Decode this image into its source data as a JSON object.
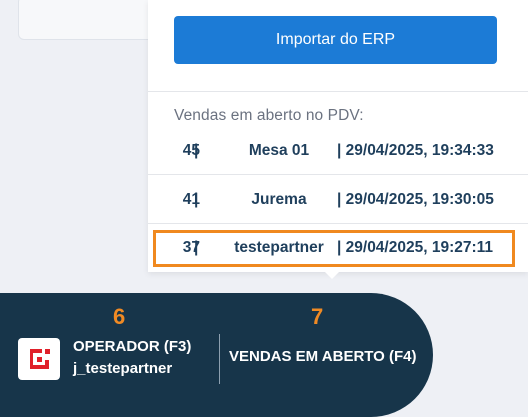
{
  "popup": {
    "import_button": "Importar do ERP",
    "section_title": "Vendas em aberto no PDV:",
    "sales": [
      {
        "number": "45",
        "name": "Mesa 01",
        "date": "| 29/04/2025, 19:34:33"
      },
      {
        "number": "41",
        "name": "Jurema",
        "date": "| 29/04/2025, 19:30:05"
      },
      {
        "number": "37",
        "name": "testepartner",
        "date": "| 29/04/2025, 19:27:11"
      }
    ],
    "row_separator": "|"
  },
  "footer": {
    "step_6": "6",
    "step_7": "7",
    "operator_label": "OPERADOR (F3)",
    "operator_user": "j_testepartner",
    "open_sales_label": "VENDAS EM ABERTO (F4)",
    "logo_icon": "brand-logo-icon"
  },
  "colors": {
    "primary": "#1c7bd6",
    "dark_bar": "#17354a",
    "highlight": "#f0891f",
    "logo_red": "#e0202a"
  }
}
